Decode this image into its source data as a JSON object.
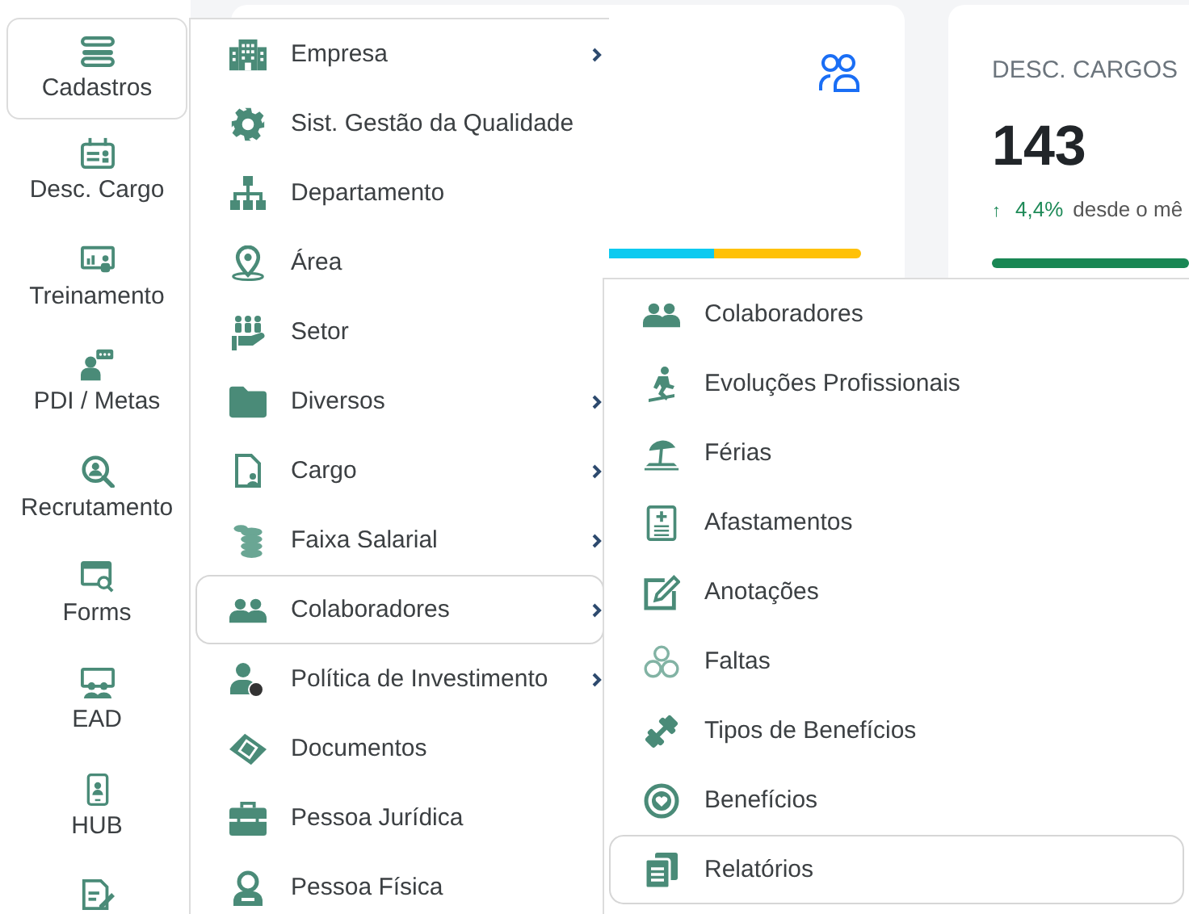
{
  "sidebar": {
    "items": [
      {
        "label": "Cadastros",
        "selected": true
      },
      {
        "label": "Desc. Cargo",
        "selected": false
      },
      {
        "label": "Treinamento",
        "selected": false
      },
      {
        "label": "PDI / Metas",
        "selected": false
      },
      {
        "label": "Recrutamento",
        "selected": false
      },
      {
        "label": "Forms",
        "selected": false
      },
      {
        "label": "EAD",
        "selected": false
      },
      {
        "label": "HUB",
        "selected": false
      },
      {
        "selected": false
      }
    ]
  },
  "cards": [
    {
      "kind": "segmented",
      "segments": [
        {
          "color": "#0dcaf0",
          "level": 0.75
        },
        {
          "color": "#ffc107",
          "level": 0.25
        }
      ]
    },
    {
      "kind": "stat",
      "title": "DESC. CARGOS",
      "value": "143",
      "trend_arrow": "↑",
      "change": "4,4%",
      "caption": "desde o mê",
      "level": 1
    }
  ],
  "menu": {
    "items": [
      {
        "label": "Empresa",
        "has_submenu": true,
        "selected": false
      },
      {
        "label": "Sist. Gestão da Qualidade",
        "has_submenu": false,
        "selected": false
      },
      {
        "label": "Departamento",
        "has_submenu": false,
        "selected": false
      },
      {
        "label": "Área",
        "has_submenu": false,
        "selected": false
      },
      {
        "label": "Setor",
        "has_submenu": false,
        "selected": false
      },
      {
        "label": "Diversos",
        "has_submenu": true,
        "selected": false
      },
      {
        "label": "Cargo",
        "has_submenu": true,
        "selected": false
      },
      {
        "label": "Faixa Salarial",
        "has_submenu": true,
        "selected": false
      },
      {
        "label": "Colaboradores",
        "has_submenu": true,
        "selected": true
      },
      {
        "label": "Política de Investimento",
        "has_submenu": true,
        "selected": false
      },
      {
        "label": "Documentos",
        "has_submenu": false,
        "selected": false
      },
      {
        "label": "Pessoa Jurídica",
        "has_submenu": false,
        "selected": false
      },
      {
        "label": "Pessoa Física",
        "has_submenu": false,
        "selected": false
      }
    ]
  },
  "submenu": {
    "items": [
      {
        "label": "Colaboradores",
        "selected": false
      },
      {
        "label": "Evoluções Profissionais",
        "selected": false
      },
      {
        "label": "Férias",
        "selected": false
      },
      {
        "label": "Afastamentos",
        "selected": false
      },
      {
        "label": "Anotações",
        "selected": false
      },
      {
        "label": "Faltas",
        "selected": false
      },
      {
        "label": "Tipos de Benefícios",
        "selected": false
      },
      {
        "label": "Benefícios",
        "selected": false
      },
      {
        "label": "Relatórios",
        "selected": true
      }
    ]
  }
}
